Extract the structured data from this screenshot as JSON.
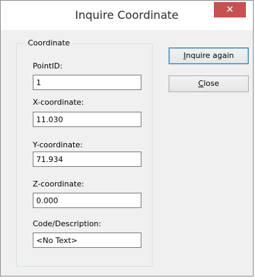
{
  "window": {
    "title": "Inquire Coordinate",
    "close_glyph": "✕"
  },
  "group": {
    "legend": "Coordinate"
  },
  "fields": {
    "point_id": {
      "label": "PointID:",
      "value": "1"
    },
    "x": {
      "label": "X-coordinate:",
      "value": "11.030"
    },
    "y": {
      "label": "Y-coordinate:",
      "value": "71.934"
    },
    "z": {
      "label": "Z-coordinate:",
      "value": "0.000"
    },
    "code": {
      "label": "Code/Description:",
      "value": "<No Text>"
    }
  },
  "buttons": {
    "inquire_again": {
      "mnemonic": "I",
      "rest": "nquire again"
    },
    "close": {
      "mnemonic": "C",
      "rest": "lose"
    }
  },
  "colors": {
    "close_button": "#c75050",
    "default_button_border": "#3c7fb1"
  }
}
